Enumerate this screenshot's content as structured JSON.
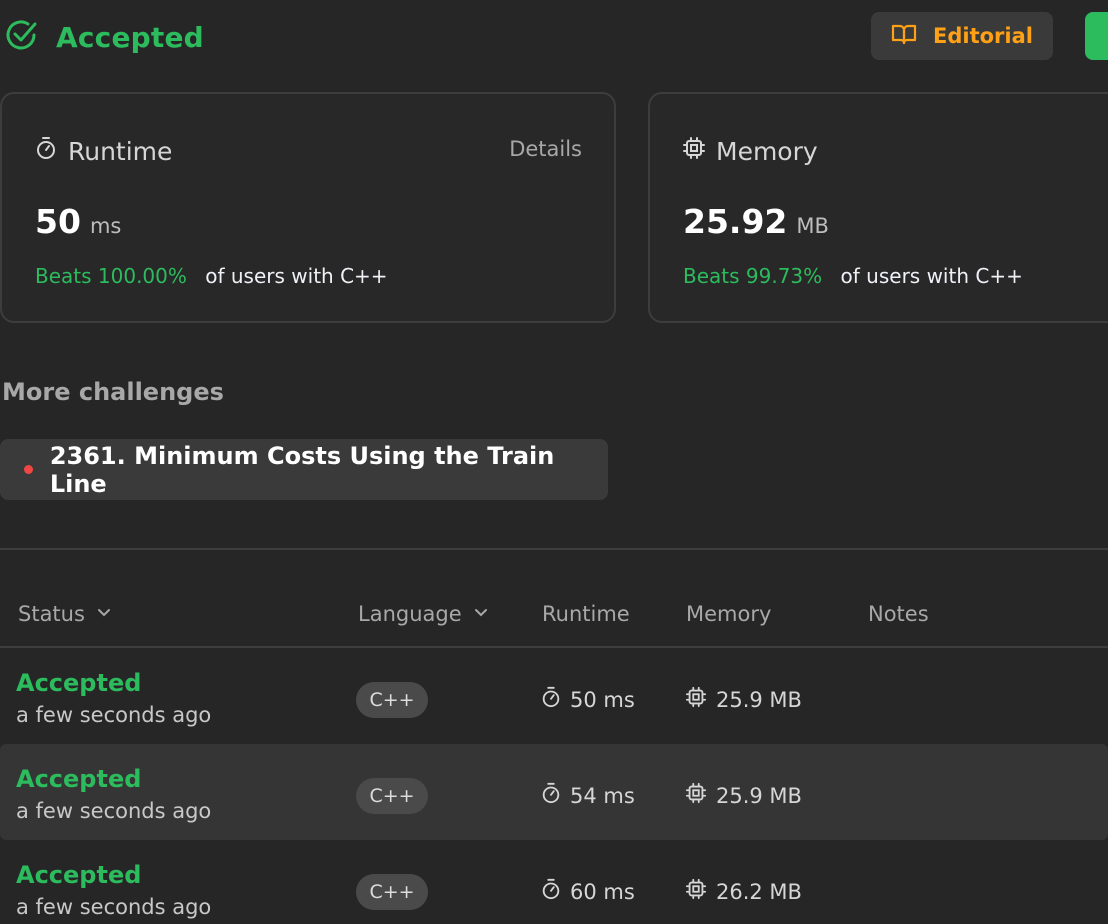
{
  "header": {
    "status": "Accepted",
    "editorial_label": "Editorial"
  },
  "runtime_card": {
    "title": "Runtime",
    "details_label": "Details",
    "value": "50",
    "unit": "ms",
    "beats": "Beats 100.00%",
    "beats_suffix": "of users with C++"
  },
  "memory_card": {
    "title": "Memory",
    "value": "25.92",
    "unit": "MB",
    "beats": "Beats 99.73%",
    "beats_suffix": "of users with C++"
  },
  "more_challenges": {
    "heading": "More challenges",
    "items": [
      {
        "label": "2361. Minimum Costs Using the Train Line"
      }
    ]
  },
  "table": {
    "headers": {
      "status": "Status",
      "language": "Language",
      "runtime": "Runtime",
      "memory": "Memory",
      "notes": "Notes"
    },
    "rows": [
      {
        "status": "Accepted",
        "time": "a few seconds ago",
        "language": "C++",
        "runtime": "50 ms",
        "memory": "25.9 MB"
      },
      {
        "status": "Accepted",
        "time": "a few seconds ago",
        "language": "C++",
        "runtime": "54 ms",
        "memory": "25.9 MB"
      },
      {
        "status": "Accepted",
        "time": "a few seconds ago",
        "language": "C++",
        "runtime": "60 ms",
        "memory": "26.2 MB"
      }
    ]
  },
  "colors": {
    "accepted": "#2cbb5d",
    "editorial": "#ffa116",
    "challenge_dot": "#ef4743",
    "background": "#262626"
  },
  "icons": {
    "status": "check-circle-icon",
    "editorial": "book-icon",
    "runtime": "stopwatch-icon",
    "memory": "chip-icon",
    "sort": "chevron-down-icon"
  }
}
